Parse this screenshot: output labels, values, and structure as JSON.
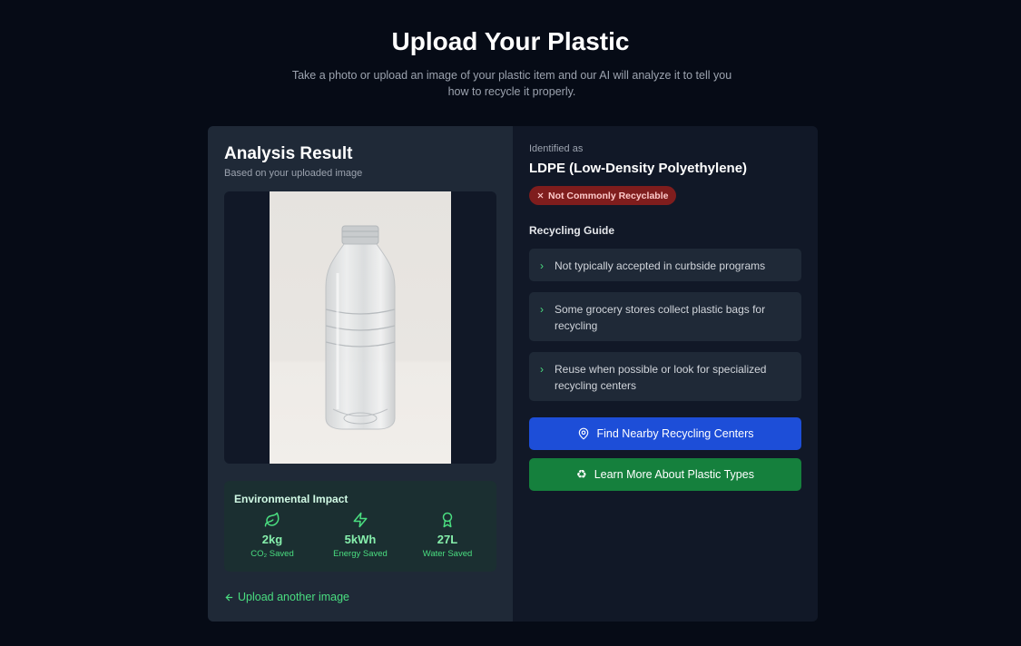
{
  "header": {
    "title": "Upload Your Plastic",
    "subtitle": "Take a photo or upload an image of your plastic item and our AI will analyze it to tell you how to recycle it properly."
  },
  "analysis": {
    "title": "Analysis Result",
    "subtitle": "Based on your uploaded image",
    "image_icon": "plastic-bottle-photo"
  },
  "impact": {
    "title": "Environmental Impact",
    "stats": [
      {
        "icon": "leaf-icon",
        "value": "2kg",
        "label": "CO₂ Saved"
      },
      {
        "icon": "lightning-icon",
        "value": "5kWh",
        "label": "Energy Saved"
      },
      {
        "icon": "award-icon",
        "value": "27L",
        "label": "Water Saved"
      }
    ]
  },
  "upload_link": "Upload another image",
  "identified": {
    "label": "Identified as",
    "name": "LDPE (Low-Density Polyethylene)",
    "badge": "Not Commonly Recyclable",
    "badge_color": "#7f1d1d"
  },
  "guide": {
    "title": "Recycling Guide",
    "items": [
      "Not typically accepted in curbside programs",
      "Some grocery stores collect plastic bags for recycling",
      "Reuse when possible or look for specialized recycling centers"
    ]
  },
  "buttons": {
    "find": "Find Nearby Recycling Centers",
    "learn": "Learn More About Plastic Types"
  },
  "colors": {
    "accent_green": "#4ade80",
    "blue_button": "#1d4ed8",
    "green_button": "#15803d",
    "background": "#060b16"
  }
}
